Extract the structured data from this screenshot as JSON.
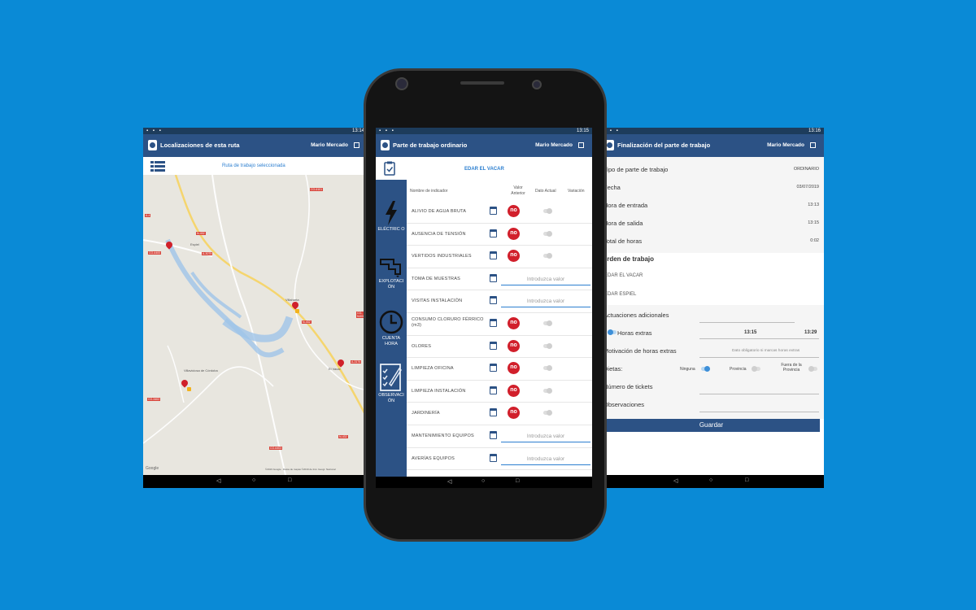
{
  "left_screen": {
    "status_time": "13:14",
    "app_title": "Localizaciones de esta ruta",
    "user_name": "Mario Mercado",
    "route_label": "Ruta de trabajo seleccionada",
    "map_attribution": "©2019 Google · Datos de mapas ©2019 de Inst. Geogr. Nacional",
    "google_logo": "Google",
    "towns": [
      "Espiel",
      "Villaharta",
      "Villaviciosa de Córdoba",
      "El Vacar"
    ],
    "road_labels": [
      "CO-6101",
      "A-4",
      "N-432",
      "CO-6400",
      "A-3075",
      "CO-5403",
      "N-432",
      "A-3176",
      "CO-3402",
      "CO-6403",
      "N-432"
    ]
  },
  "middle_screen": {
    "status_time": "13:15",
    "app_title": "Parte de trabajo ordinario",
    "user_name": "Mario Mercado",
    "site_name": "EDAR EL VACAR",
    "columns": {
      "indicator": "Nombre de indicador",
      "previous": "Valor Anterior",
      "current": "Dato Actual",
      "variation": "Variación"
    },
    "sidebar": [
      {
        "label": "ELÉCTRIC O",
        "icon": "lightning-icon"
      },
      {
        "label": "EXPLOTACI ÓN",
        "icon": "pipe-icon"
      },
      {
        "label": "CUENTA HORA",
        "icon": "clock-icon"
      },
      {
        "label": "OBSERVACI ÓN",
        "icon": "checklist-icon"
      }
    ],
    "no_label": "no",
    "input_placeholder": "Introduzca valor",
    "rows": [
      {
        "name": "ALIVIO DE AGUA BRUTA",
        "type": "no"
      },
      {
        "name": "AUSENCIA DE TENSIÓN",
        "type": "no"
      },
      {
        "name": "VERTIDOS INDUSTRIALES",
        "type": "no"
      },
      {
        "name": "TOMA DE MUESTRAS",
        "type": "input"
      },
      {
        "name": "VISITAS INSTALACIÓN",
        "type": "input"
      },
      {
        "name": "CONSUMO CLORURO FÉRRICO (m3)",
        "type": "no"
      },
      {
        "name": "OLORES",
        "type": "no"
      },
      {
        "name": "LIMPIEZA OFICINA",
        "type": "no"
      },
      {
        "name": "LIMPIEZA INSTALACIÓN",
        "type": "no"
      },
      {
        "name": "JARDINERÍA",
        "type": "no"
      },
      {
        "name": "MANTENIMIENTO EQUIPOS",
        "type": "input"
      },
      {
        "name": "AVERÍAS EQUIPOS",
        "type": "input"
      }
    ]
  },
  "right_screen": {
    "status_time": "13:16",
    "app_title": "Finalización del parte de trabajo",
    "user_name": "Mario Mercado",
    "tipo_label": "Tipo de parte de trabajo",
    "tipo_value": "ORDINARIO",
    "fecha_label": "Fecha",
    "fecha_value": "03/07/2019",
    "entrada_label": "Hora de entrada",
    "entrada_value": "13:13",
    "salida_label": "Hora de salida",
    "salida_value": "13:15",
    "total_label": "Total de horas",
    "total_value": "0:02",
    "orden_label": "Orden de trabajo",
    "orden_items": [
      "EDAR EL VACAR",
      "EDAR ESPIEL"
    ],
    "actuaciones_label": "Actuaciones adicionales",
    "horas_extras_label": "Horas extras",
    "horas_extras_from": "13:15",
    "horas_extras_to": "13:29",
    "motivacion_label": "Motivación de horas extras",
    "motivacion_placeholder": "Dato obligatorio si marcas horas extras",
    "dietas_label": "Dietas:",
    "dietas_options": [
      "Ninguna",
      "Provincia",
      "Fuera de la Provincia"
    ],
    "tickets_label": "Número de tickets",
    "observaciones_label": "Observaciones",
    "save_label": "Guardar"
  }
}
